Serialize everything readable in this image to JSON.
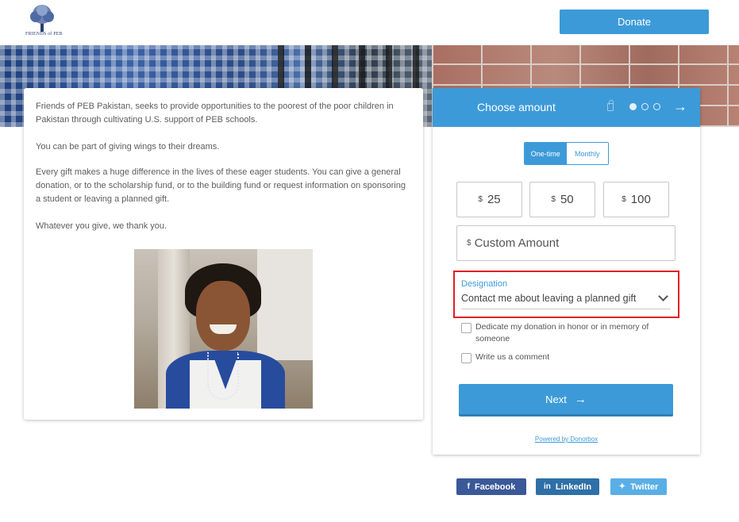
{
  "header": {
    "logo_text": "FRIENDS of PEB",
    "donate_label": "Donate"
  },
  "intro": {
    "paragraphs": [
      "Friends of PEB Pakistan, seeks to provide opportunities to the poorest of the poor children in Pakistan through cultivating U.S. support of PEB schools.",
      "You can be part of giving wings to their dreams.",
      "Every gift makes a huge difference in the lives of these eager students. You can give a general donation, or to the scholarship fund, or to the building fund or request information on sponsoring a student or leaving a planned gift.",
      "Whatever you give, we thank you."
    ]
  },
  "donation_form": {
    "title": "Choose amount",
    "frequency": {
      "one_time": "One-time",
      "monthly": "Monthly",
      "selected": "One-time"
    },
    "currency_symbol": "$",
    "amounts": [
      "25",
      "50",
      "100"
    ],
    "custom_placeholder": "Custom Amount",
    "designation_label": "Designation",
    "designation_value": "Contact me about leaving a planned gift",
    "checkbox_dedicate": "Dedicate my donation in honor or in memory of someone",
    "checkbox_comment": "Write us a comment",
    "next_label": "Next",
    "powered_by": "Powered by Donorbox",
    "step": {
      "current": 1,
      "total": 3
    }
  },
  "share": {
    "facebook": "Facebook",
    "linkedin": "LinkedIn",
    "twitter": "Twitter"
  },
  "colors": {
    "accent": "#3d9ad8",
    "highlight": "#e01f26",
    "facebook": "#3b5998",
    "linkedin": "#2f6fa8",
    "twitter": "#5aaee6"
  }
}
